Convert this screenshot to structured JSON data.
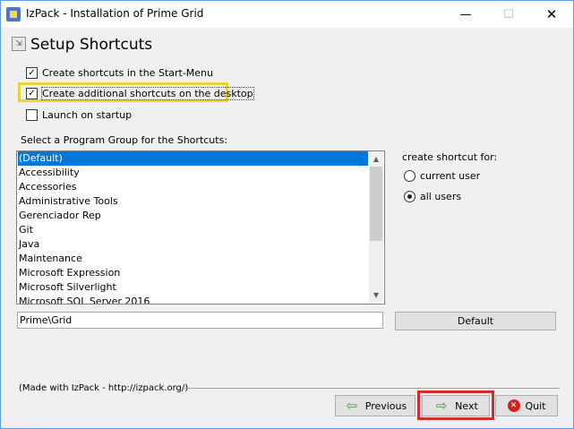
{
  "window": {
    "title": "IzPack - Installation of  Prime Grid",
    "minimize_glyph": "—",
    "maximize_glyph": "☐",
    "close_glyph": "✕"
  },
  "panel": {
    "title": "Setup Shortcuts"
  },
  "checkboxes": [
    {
      "label": "Create shortcuts in the Start-Menu",
      "checked": true
    },
    {
      "label": "Create additional shortcuts on the desktop",
      "checked": true
    },
    {
      "label": "Launch on startup",
      "checked": false
    }
  ],
  "program_group": {
    "label": "Select a Program Group for the Shortcuts:",
    "items": [
      "(Default)",
      "Accessibility",
      "Accessories",
      "Administrative Tools",
      "Gerenciador Rep",
      "Git",
      "Java",
      "Maintenance",
      "Microsoft Expression",
      "Microsoft Silverlight",
      "Microsoft SQL Server 2016"
    ],
    "selected_index": 0,
    "value": "Prime\\Grid",
    "default_button": "Default"
  },
  "create_for": {
    "label": "create shortcut for:",
    "options": [
      "current user",
      "all users"
    ],
    "selected_index": 1
  },
  "footer": {
    "credit": "(Made with IzPack - http://izpack.org/)"
  },
  "buttons": {
    "previous": "Previous",
    "next": "Next",
    "quit": "Quit"
  },
  "colors": {
    "selection": "#0078d7",
    "highlight_box": "#e6d23a",
    "next_outline": "#d42b2b",
    "window_border": "#5d9ee0"
  }
}
